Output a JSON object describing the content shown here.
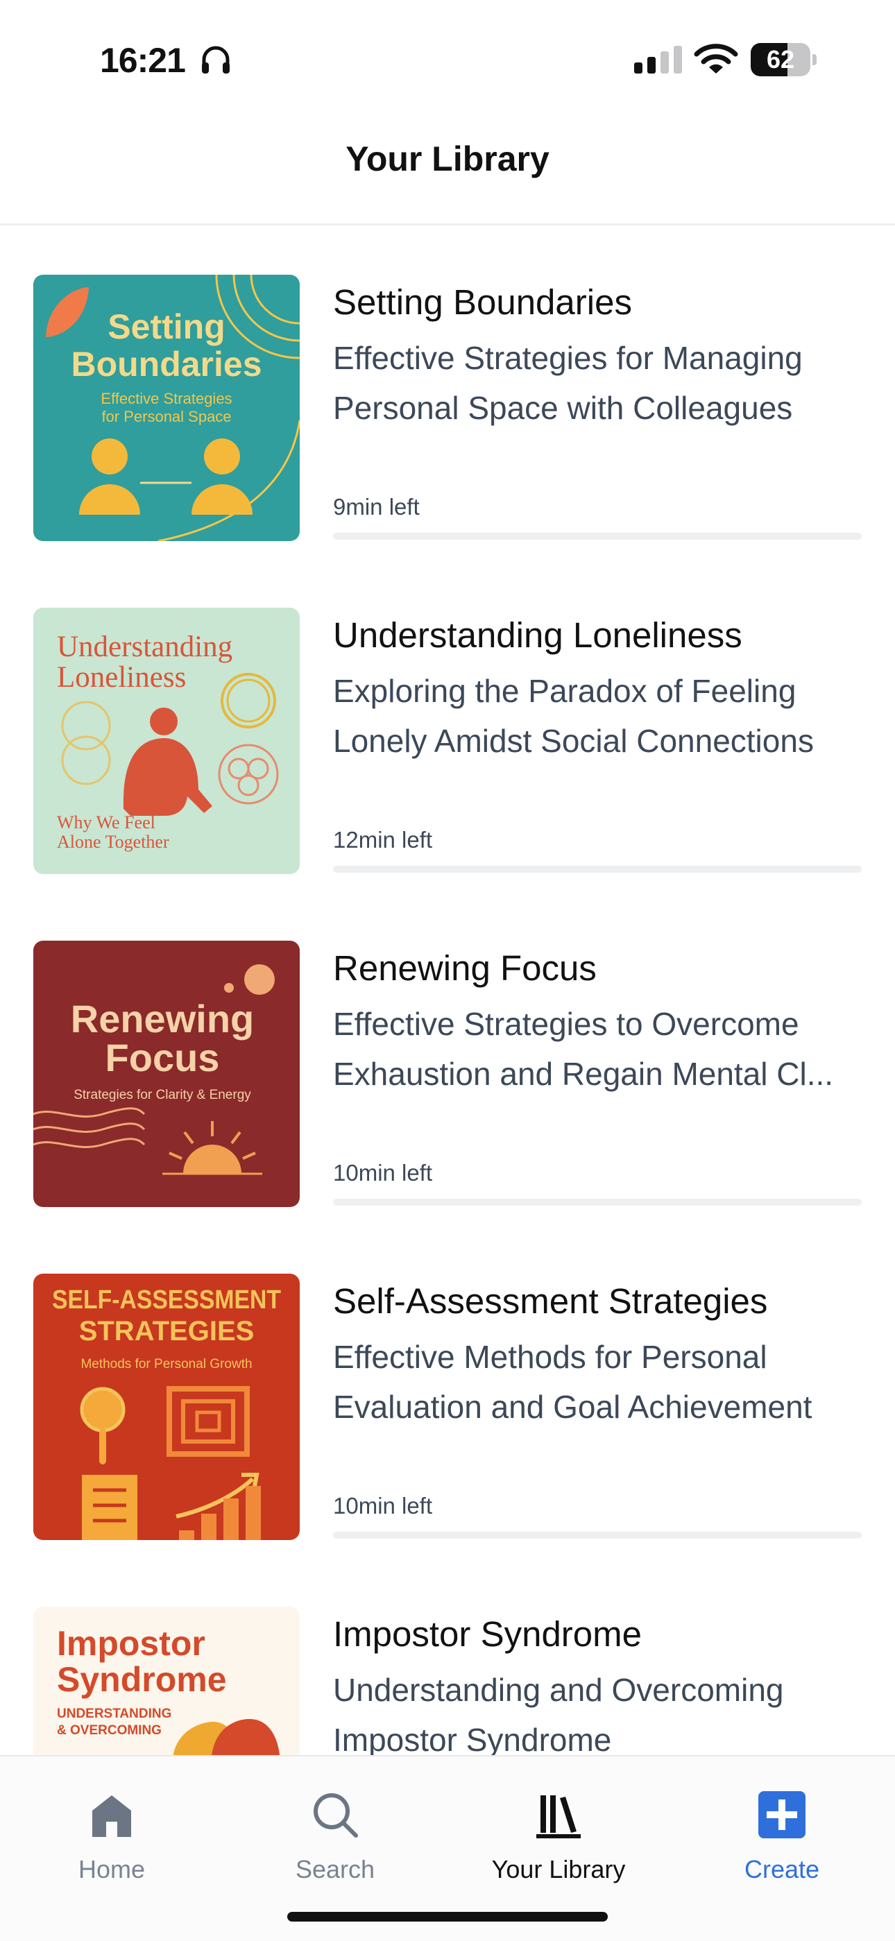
{
  "status_bar": {
    "time": "16:21",
    "battery": "62",
    "battery_level": 0.62
  },
  "header": {
    "title": "Your Library"
  },
  "colors": {
    "accent": "#2f6fdc",
    "progress_track": "#eeeff1",
    "subtitle": "#3c4858",
    "inactive_tab": "#7a8390"
  },
  "books": [
    {
      "title": "Setting Boundaries",
      "subtitle": "Effective Strategies for Managing Personal Space with Colleagues",
      "time_left": "9min left",
      "progress": 0.0,
      "cover": {
        "line1": "Setting",
        "line2": "Boundaries",
        "tagline1": "Effective Strategies",
        "tagline2": "for Personal Space",
        "bg": "#2f9e9c"
      }
    },
    {
      "title": "Understanding Loneliness",
      "subtitle": "Exploring the Paradox of Feeling Lonely Amidst Social Connections",
      "time_left": "12min left",
      "progress": 0.0,
      "cover": {
        "line1": "Understanding",
        "line2": "Loneliness",
        "tagline1": "Why We Feel",
        "tagline2": "Alone Together",
        "bg": "#c8e6d2"
      }
    },
    {
      "title": "Renewing Focus",
      "subtitle": "Effective Strategies to Overcome Exhaustion and Regain Mental Cl...",
      "time_left": "10min left",
      "progress": 0.0,
      "cover": {
        "line1": "Renewing",
        "line2": "Focus",
        "tagline1": "Strategies for Clarity & Energy",
        "bg": "#8a2a2a"
      }
    },
    {
      "title": "Self-Assessment Strategies",
      "subtitle": "Effective Methods for Personal Evaluation and Goal Achievement",
      "time_left": "10min left",
      "progress": 0.0,
      "cover": {
        "line1": "SELF-ASSESSMENT",
        "line2": "STRATEGIES",
        "tagline1": "Methods for Personal Growth",
        "bg": "#c7381f"
      }
    },
    {
      "title": "Impostor Syndrome",
      "subtitle": "Understanding and Overcoming Impostor Syndrome",
      "cover": {
        "line1": "Impostor",
        "line2": "Syndrome",
        "tagline1": "UNDERSTANDING",
        "tagline2": "& OVERCOMING",
        "bg": "#fcf6ec"
      }
    }
  ],
  "tabbar": {
    "items": [
      {
        "label": "Home",
        "icon": "home-icon"
      },
      {
        "label": "Search",
        "icon": "search-icon"
      },
      {
        "label": "Your Library",
        "icon": "library-icon",
        "active": true
      },
      {
        "label": "Create",
        "icon": "plus-icon"
      }
    ]
  }
}
